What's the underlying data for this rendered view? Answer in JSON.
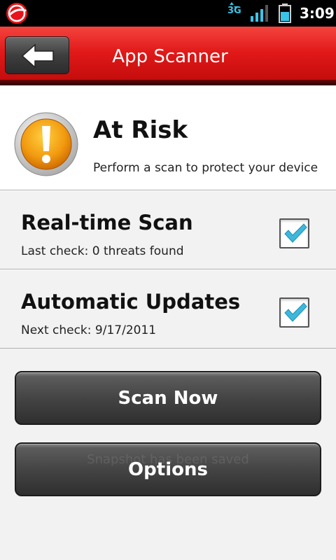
{
  "status_bar": {
    "network_type": "3G",
    "time": "3:09",
    "icons": [
      "trendmicro-logo-icon",
      "data-arrows-icon",
      "signal-strength-icon",
      "battery-icon"
    ],
    "accent_color": "#3cc4e8"
  },
  "title_bar": {
    "title": "App Scanner",
    "back_icon": "arrow-left-icon",
    "color": "#e01818"
  },
  "status_panel": {
    "icon": "warning-exclamation-icon",
    "title": "At Risk",
    "subtitle": "Perform a scan to protect your device"
  },
  "settings": [
    {
      "title": "Real-time Scan",
      "detail": "Last check: 0 threats found",
      "checked": true
    },
    {
      "title": "Automatic Updates",
      "detail": "Next check: 9/17/2011",
      "checked": true
    }
  ],
  "actions": {
    "scan_label": "Scan Now",
    "options_label": "Options"
  },
  "toast": {
    "message": "Snapshot has been saved"
  }
}
